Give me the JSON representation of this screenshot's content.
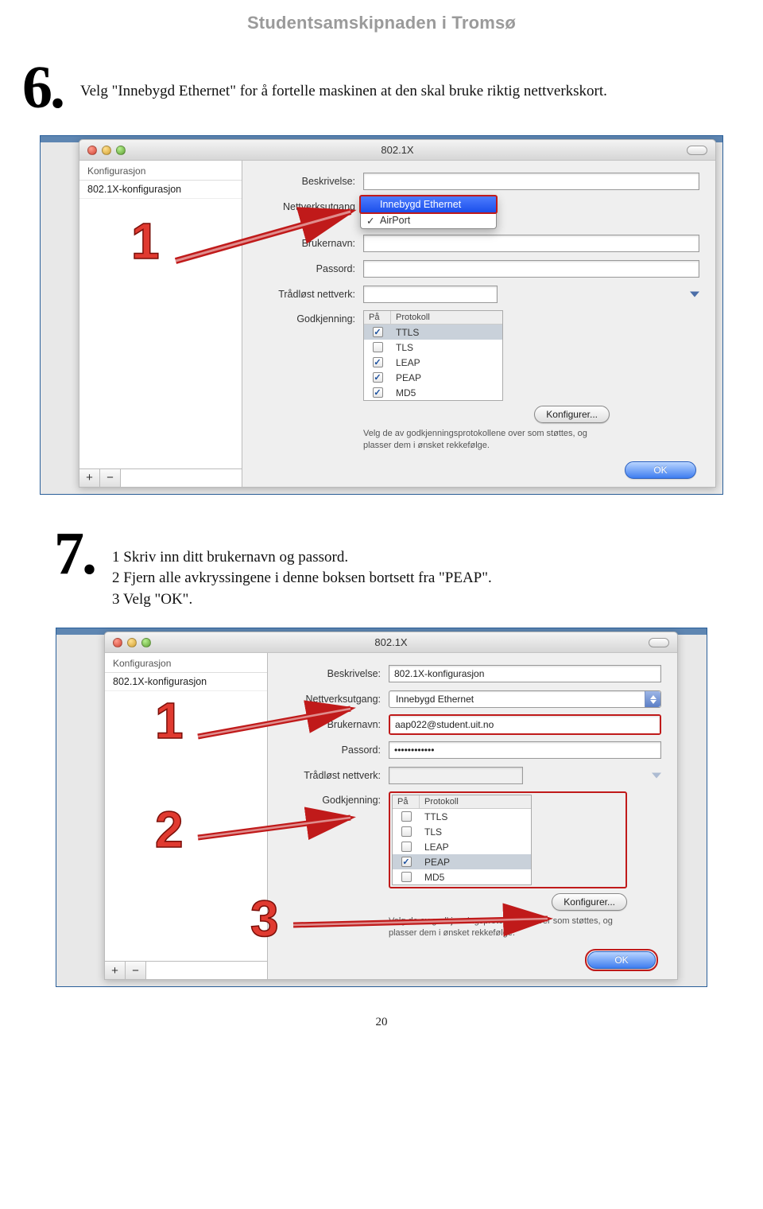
{
  "header": "Studentsamskipnaden i Tromsø",
  "step6": {
    "num": "6.",
    "text": "Velg \"Innebygd Ethernet\" for å fortelle maskinen at den skal bruke riktig nettverkskort."
  },
  "step7": {
    "num": "7.",
    "line1": "1 Skriv inn ditt brukernavn og passord.",
    "line2": "2 Fjern alle avkryssingene i denne boksen bortsett fra \"PEAP\".",
    "line3": "3 Velg \"OK\"."
  },
  "shot1": {
    "title": "802.1X",
    "sidebar_header": "Konfigurasjon",
    "sidebar_item": "802.1X-konfigurasjon",
    "labels": {
      "beskrivelse": "Beskrivelse:",
      "nettverk": "Nettverksutgang",
      "bruker": "Brukernavn:",
      "passord": "Passord:",
      "wifi": "Trådløst nettverk:",
      "godkj": "Godkjenning:"
    },
    "dropdown": {
      "selected": "Innebygd Ethernet",
      "other": "AirPort"
    },
    "protocols": {
      "hdr_on": "På",
      "hdr_proto": "Protokoll",
      "rows": [
        {
          "name": "TTLS",
          "on": true,
          "sel": true
        },
        {
          "name": "TLS",
          "on": false
        },
        {
          "name": "LEAP",
          "on": true
        },
        {
          "name": "PEAP",
          "on": true
        },
        {
          "name": "MD5",
          "on": true
        }
      ]
    },
    "konfig_btn": "Konfigurer...",
    "hint": "Velg de av godkjenningsprotokollene over som støttes, og plasser dem i ønsket rekkefølge.",
    "ok": "OK",
    "plus": "+",
    "minus": "−"
  },
  "shot2": {
    "title": "802.1X",
    "sidebar_header": "Konfigurasjon",
    "sidebar_item": "802.1X-konfigurasjon",
    "labels": {
      "beskrivelse": "Beskrivelse:",
      "nettverk": "Nettverksutgang:",
      "bruker": "Brukernavn:",
      "passord": "Passord:",
      "wifi": "Trådløst nettverk:",
      "godkj": "Godkjenning:"
    },
    "values": {
      "beskrivelse": "802.1X-konfigurasjon",
      "nettverk": "Innebygd Ethernet",
      "bruker": "aap022@student.uit.no",
      "passord": "••••••••••••"
    },
    "protocols": {
      "hdr_on": "På",
      "hdr_proto": "Protokoll",
      "rows": [
        {
          "name": "TTLS",
          "on": false
        },
        {
          "name": "TLS",
          "on": false
        },
        {
          "name": "LEAP",
          "on": false
        },
        {
          "name": "PEAP",
          "on": true,
          "sel": true
        },
        {
          "name": "MD5",
          "on": false
        }
      ]
    },
    "konfig_btn": "Konfigurer...",
    "hint": "Velg de av godkjenningsprotokollene over som støttes, og plasser dem i ønsket rekkefølge.",
    "ok": "OK",
    "plus": "+",
    "minus": "−"
  },
  "page_number": "20"
}
